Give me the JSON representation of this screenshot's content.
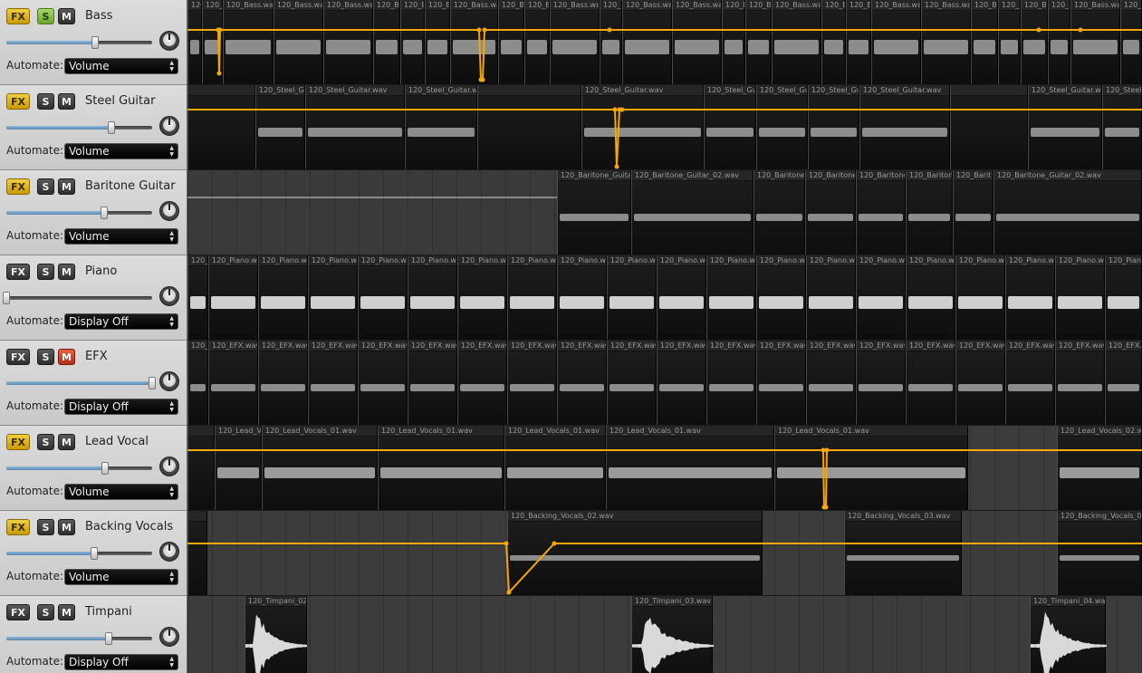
{
  "labels": {
    "automate": "Automate:"
  },
  "colors": {
    "automation": "#f5a800",
    "fx_on": "#e6c21e",
    "solo_on": "#8cc43f",
    "mute_on": "#d84a2e",
    "slider_fill": "#6f9bc4"
  },
  "tracks": [
    {
      "name": "Bass",
      "fx": "FX",
      "solo": "S",
      "mute": "M",
      "fx_on": true,
      "solo_on": true,
      "mute_on": false,
      "volume": 0.61,
      "automate": "Volume",
      "clips": [
        {
          "a": 0,
          "b": 16,
          "t": "120_B"
        },
        {
          "a": 16,
          "b": 39,
          "t": "120_Bass.w"
        },
        {
          "a": 39,
          "b": 95,
          "t": "120_Bass.wav"
        },
        {
          "a": 95,
          "b": 150,
          "t": "120_Bass.wav"
        },
        {
          "a": 150,
          "b": 205,
          "t": "120_Bass.wav"
        },
        {
          "a": 205,
          "b": 235,
          "t": "120_B"
        },
        {
          "a": 235,
          "b": 262,
          "t": "120_B"
        },
        {
          "a": 262,
          "b": 290,
          "t": "120_B"
        },
        {
          "a": 290,
          "b": 343,
          "t": "120_Bass.wav"
        },
        {
          "a": 343,
          "b": 372,
          "t": "120_B"
        },
        {
          "a": 372,
          "b": 400,
          "t": "120_B"
        },
        {
          "a": 400,
          "b": 455,
          "t": "120_Bass.wav"
        },
        {
          "a": 455,
          "b": 480,
          "t": "120_B"
        },
        {
          "a": 480,
          "b": 535,
          "t": "120_Bass.wav"
        },
        {
          "a": 535,
          "b": 590,
          "t": "120_Bass.wav"
        },
        {
          "a": 590,
          "b": 616,
          "t": "120_B"
        },
        {
          "a": 616,
          "b": 645,
          "t": "120_B"
        },
        {
          "a": 645,
          "b": 700,
          "t": "120_Bass.wav"
        },
        {
          "a": 700,
          "b": 727,
          "t": "120_B"
        },
        {
          "a": 727,
          "b": 755,
          "t": "120_B"
        },
        {
          "a": 755,
          "b": 810,
          "t": "120_Bass.wav"
        },
        {
          "a": 810,
          "b": 865,
          "t": "120_Bass.wav"
        },
        {
          "a": 865,
          "b": 895,
          "t": "120_B"
        },
        {
          "a": 895,
          "b": 920,
          "t": "120_B"
        },
        {
          "a": 920,
          "b": 950,
          "t": "120_B"
        },
        {
          "a": 950,
          "b": 975,
          "t": "120_B"
        },
        {
          "a": 975,
          "b": 1030,
          "t": "120_Bass.wav"
        },
        {
          "a": 1030,
          "b": 1054,
          "t": "120_B"
        }
      ],
      "automation": [
        [
          0,
          0.35
        ],
        [
          34,
          0.35
        ],
        [
          35,
          0.9
        ],
        [
          36,
          0.35
        ],
        [
          322,
          0.35
        ],
        [
          324,
          0.98
        ],
        [
          326,
          0.98
        ],
        [
          328,
          0.35
        ],
        [
          466,
          0.35
        ],
        [
          940,
          0.35
        ],
        [
          986,
          0.35
        ],
        [
          1054,
          0.35
        ]
      ]
    },
    {
      "name": "Steel Guitar",
      "fx": "FX",
      "solo": "S",
      "mute": "M",
      "fx_on": true,
      "solo_on": false,
      "mute_on": false,
      "volume": 0.72,
      "automate": "Volume",
      "clips": [
        {
          "a": 0,
          "b": 75,
          "t": ""
        },
        {
          "a": 75,
          "b": 130,
          "t": "120_Steel_Gu"
        },
        {
          "a": 130,
          "b": 240,
          "t": "120_Steel_Guitar.wav"
        },
        {
          "a": 240,
          "b": 320,
          "t": "120_Steel_Guitar.wav"
        },
        {
          "a": 320,
          "b": 435,
          "t": ""
        },
        {
          "a": 435,
          "b": 570,
          "t": "120_Steel_Guitar.wav"
        },
        {
          "a": 570,
          "b": 628,
          "t": "120_Steel_Gu"
        },
        {
          "a": 628,
          "b": 685,
          "t": "120_Steel_Gui"
        },
        {
          "a": 685,
          "b": 742,
          "t": "120_Steel_Gui"
        },
        {
          "a": 742,
          "b": 842,
          "t": "120_Steel_Guitar.wav"
        },
        {
          "a": 842,
          "b": 928,
          "t": ""
        },
        {
          "a": 928,
          "b": 1010,
          "t": "120_Steel_Guitar.wav"
        },
        {
          "a": 1010,
          "b": 1054,
          "t": "120_Steel_Gu"
        }
      ],
      "automation": [
        [
          0,
          0.28
        ],
        [
          472,
          0.28
        ],
        [
          474,
          1.0
        ],
        [
          477,
          0.28
        ],
        [
          480,
          0.28
        ],
        [
          1054,
          0.28
        ]
      ]
    },
    {
      "name": "Baritone Guitar",
      "fx": "FX",
      "solo": "S",
      "mute": "M",
      "fx_on": true,
      "solo_on": false,
      "mute_on": false,
      "volume": 0.67,
      "automate": "Volume",
      "clips": [
        {
          "a": 408,
          "b": 490,
          "t": "120_Baritone_Guita"
        },
        {
          "a": 490,
          "b": 625,
          "t": "120_Baritone_Guitar_02.wav"
        },
        {
          "a": 625,
          "b": 682,
          "t": "120_Baritone"
        },
        {
          "a": 682,
          "b": 738,
          "t": "120_Baritone"
        },
        {
          "a": 738,
          "b": 793,
          "t": "120_Baritone"
        },
        {
          "a": 793,
          "b": 845,
          "t": "120_Baritone"
        },
        {
          "a": 845,
          "b": 890,
          "t": "120_Barit"
        },
        {
          "a": 890,
          "b": 1054,
          "t": "120_Baritone_Guitar_02.wav"
        }
      ],
      "automation": []
    },
    {
      "name": "Piano",
      "fx": "FX",
      "solo": "S",
      "mute": "M",
      "fx_on": false,
      "solo_on": false,
      "mute_on": false,
      "volume": 0.0,
      "automate": "Display Off",
      "clips": [
        {
          "a": 0,
          "b": 23,
          "t": "120_Piano.wav"
        },
        {
          "a": 23,
          "b": 78,
          "t": "120_Piano.wav"
        },
        {
          "a": 78,
          "b": 133,
          "t": "120_Piano.wav"
        },
        {
          "a": 133,
          "b": 188,
          "t": "120_Piano.wav"
        },
        {
          "a": 188,
          "b": 243,
          "t": "120_Piano.wav"
        },
        {
          "a": 243,
          "b": 298,
          "t": "120_Piano.wav"
        },
        {
          "a": 298,
          "b": 353,
          "t": "120_Piano.wav"
        },
        {
          "a": 353,
          "b": 408,
          "t": "120_Piano.wav"
        },
        {
          "a": 408,
          "b": 463,
          "t": "120_Piano.wav"
        },
        {
          "a": 463,
          "b": 518,
          "t": "120_Piano.wav"
        },
        {
          "a": 518,
          "b": 573,
          "t": "120_Piano.wav"
        },
        {
          "a": 573,
          "b": 628,
          "t": "120_Piano.wav"
        },
        {
          "a": 628,
          "b": 683,
          "t": "120_Piano.wav"
        },
        {
          "a": 683,
          "b": 738,
          "t": "120_Piano.wav"
        },
        {
          "a": 738,
          "b": 793,
          "t": "120_Piano.wav"
        },
        {
          "a": 793,
          "b": 848,
          "t": "120_Piano.wav"
        },
        {
          "a": 848,
          "b": 903,
          "t": "120_Piano.wav"
        },
        {
          "a": 903,
          "b": 958,
          "t": "120_Piano.wav"
        },
        {
          "a": 958,
          "b": 1013,
          "t": "120_Piano.wav"
        },
        {
          "a": 1013,
          "b": 1054,
          "t": "120_Piano.wav"
        }
      ],
      "automation": []
    },
    {
      "name": "EFX",
      "fx": "FX",
      "solo": "S",
      "mute": "M",
      "fx_on": false,
      "solo_on": false,
      "mute_on": true,
      "volume": 1.0,
      "automate": "Display Off",
      "clips": [
        {
          "a": 0,
          "b": 23,
          "t": "120_EFX.wav"
        },
        {
          "a": 23,
          "b": 78,
          "t": "120_EFX.wav"
        },
        {
          "a": 78,
          "b": 133,
          "t": "120_EFX.wav"
        },
        {
          "a": 133,
          "b": 188,
          "t": "120_EFX.wav"
        },
        {
          "a": 188,
          "b": 243,
          "t": "120_EFX.wav"
        },
        {
          "a": 243,
          "b": 298,
          "t": "120_EFX.wav"
        },
        {
          "a": 298,
          "b": 353,
          "t": "120_EFX.wav"
        },
        {
          "a": 353,
          "b": 408,
          "t": "120_EFX.wav"
        },
        {
          "a": 408,
          "b": 463,
          "t": "120_EFX.wav"
        },
        {
          "a": 463,
          "b": 518,
          "t": "120_EFX.wav"
        },
        {
          "a": 518,
          "b": 573,
          "t": "120_EFX.wav"
        },
        {
          "a": 573,
          "b": 628,
          "t": "120_EFX.wav"
        },
        {
          "a": 628,
          "b": 683,
          "t": "120_EFX.wav"
        },
        {
          "a": 683,
          "b": 738,
          "t": "120_EFX.wav"
        },
        {
          "a": 738,
          "b": 793,
          "t": "120_EFX.wav"
        },
        {
          "a": 793,
          "b": 848,
          "t": "120_EFX.wav"
        },
        {
          "a": 848,
          "b": 903,
          "t": "120_EFX.wav"
        },
        {
          "a": 903,
          "b": 958,
          "t": "120_EFX.wav"
        },
        {
          "a": 958,
          "b": 1013,
          "t": "120_EFX.wav"
        },
        {
          "a": 1013,
          "b": 1054,
          "t": "120_EFX.wav"
        }
      ],
      "automation": []
    },
    {
      "name": "Lead Vocal",
      "fx": "FX",
      "solo": "S",
      "mute": "M",
      "fx_on": true,
      "solo_on": false,
      "mute_on": false,
      "volume": 0.68,
      "automate": "Volume",
      "clips": [
        {
          "a": 0,
          "b": 30,
          "t": ""
        },
        {
          "a": 30,
          "b": 82,
          "t": "120_Lead_V"
        },
        {
          "a": 82,
          "b": 210,
          "t": "120_Lead_Vocals_01.wav"
        },
        {
          "a": 210,
          "b": 350,
          "t": "120_Lead_Vocals_01.wav"
        },
        {
          "a": 350,
          "b": 462,
          "t": "120_Lead_Vocals_01.wav"
        },
        {
          "a": 462,
          "b": 648,
          "t": "120_Lead_Vocals_01.wav"
        },
        {
          "a": 648,
          "b": 862,
          "t": "120_Lead_Vocals_01.wav"
        },
        {
          "a": 960,
          "b": 1054,
          "t": "120_Lead_Vocals_02.wav"
        }
      ],
      "automation": [
        [
          0,
          0.28
        ],
        [
          702,
          0.28
        ],
        [
          703,
          1.0
        ],
        [
          705,
          1.0
        ],
        [
          706,
          0.28
        ],
        [
          1054,
          0.28
        ]
      ]
    },
    {
      "name": "Backing Vocals",
      "fx": "FX",
      "solo": "S",
      "mute": "M",
      "fx_on": true,
      "solo_on": false,
      "mute_on": false,
      "volume": 0.6,
      "automate": "Volume",
      "clips": [
        {
          "a": 0,
          "b": 22,
          "t": ""
        },
        {
          "a": 353,
          "b": 635,
          "t": "120_Backing_Vocals_02.wav"
        },
        {
          "a": 725,
          "b": 855,
          "t": "120_Backing_Vocals_03.wav"
        },
        {
          "a": 960,
          "b": 1054,
          "t": "120_Backing_Vocals_04.wav"
        }
      ],
      "automation": [
        [
          0,
          0.38
        ],
        [
          352,
          0.38
        ],
        [
          355,
          1.0
        ],
        [
          405,
          0.38
        ],
        [
          1054,
          0.38
        ]
      ]
    },
    {
      "name": "Timpani",
      "fx": "FX",
      "solo": "S",
      "mute": "M",
      "fx_on": false,
      "solo_on": false,
      "mute_on": false,
      "volume": 0.7,
      "automate": "Display Off",
      "clips": [
        {
          "a": 63,
          "b": 132,
          "t": "120_Timpani_02.wav",
          "kind": "hit"
        },
        {
          "a": 490,
          "b": 580,
          "t": "120_Timpani_03.wav",
          "kind": "hit"
        },
        {
          "a": 930,
          "b": 1014,
          "t": "120_Timpani_04.wav",
          "kind": "hit"
        }
      ],
      "automation": []
    }
  ]
}
